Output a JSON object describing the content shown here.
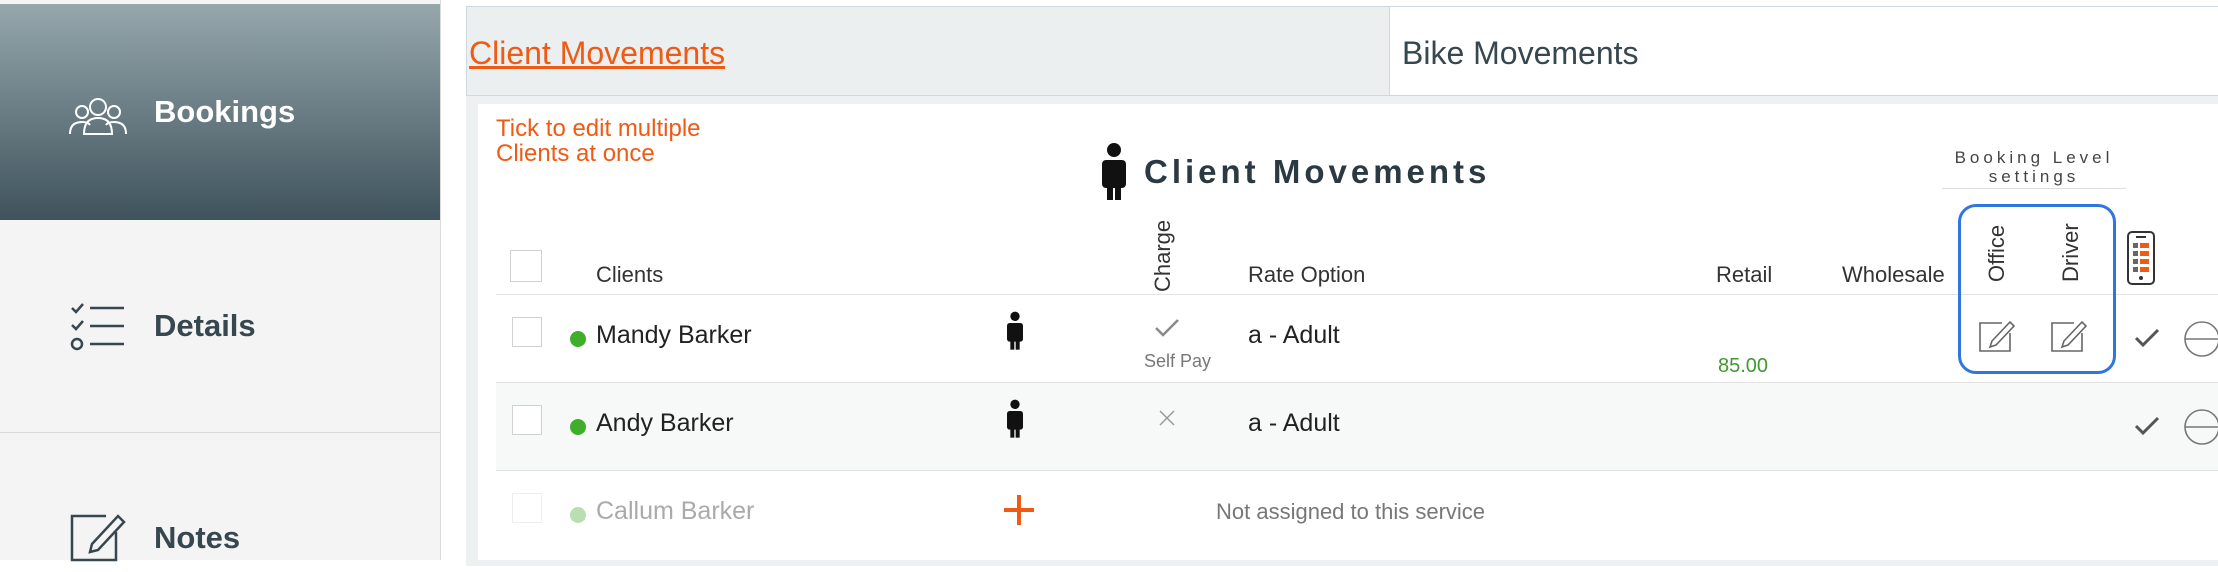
{
  "sidebar": {
    "items": [
      {
        "label": "Bookings",
        "icon": "users-icon",
        "active": true
      },
      {
        "label": "Details",
        "icon": "checklist-icon",
        "active": false
      },
      {
        "label": "Notes",
        "icon": "edit-note-icon",
        "active": false
      }
    ]
  },
  "tabs": [
    {
      "label": "Client Movements",
      "active": true
    },
    {
      "label": "Bike Movements",
      "active": false
    }
  ],
  "panel": {
    "hint": "Tick to edit multiple Clients at once",
    "title": "Client Movements",
    "booking_level": "Booking Level settings",
    "headers": {
      "clients": "Clients",
      "charge": "Charge",
      "rate_option": "Rate Option",
      "retail": "Retail",
      "wholesale": "Wholesale",
      "office": "Office",
      "driver": "Driver"
    }
  },
  "rows": [
    {
      "name": "Mandy Barker",
      "charge_note": "Self Pay",
      "rate": "a - Adult",
      "retail": "85.00"
    },
    {
      "name": "Andy Barker",
      "rate": "a - Adult"
    },
    {
      "name": "Callum Barker",
      "status": "Not assigned to this service"
    }
  ],
  "colors": {
    "accent": "#ef5a14",
    "active_dot": "#3fae2a",
    "inactive_dot": "#b9dfb0",
    "retail_text": "#3f9a2e",
    "highlight_border": "#2f76e0",
    "sidebar_active_top": "#96a8ac",
    "sidebar_active_bottom": "#3f535c"
  }
}
